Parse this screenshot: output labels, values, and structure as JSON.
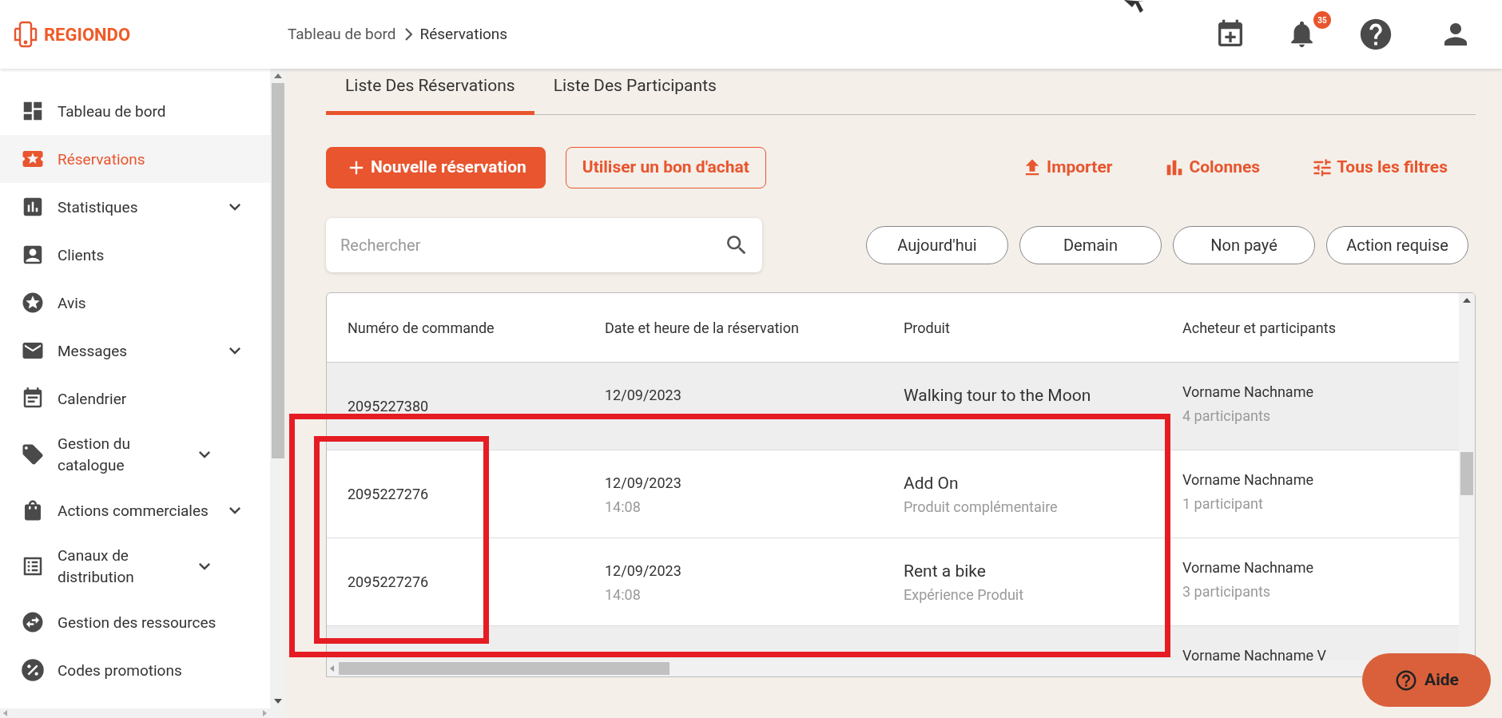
{
  "header": {
    "logo": "REGIONDO",
    "breadcrumb": [
      "Tableau de bord",
      "Réservations"
    ],
    "notifications_badge": "35"
  },
  "sidebar": {
    "items": [
      {
        "label": "Tableau de bord",
        "selected": false,
        "expandable": false
      },
      {
        "label": "Réservations",
        "selected": true,
        "expandable": false
      },
      {
        "label": "Statistiques",
        "selected": false,
        "expandable": true
      },
      {
        "label": "Clients",
        "selected": false,
        "expandable": false
      },
      {
        "label": "Avis",
        "selected": false,
        "expandable": false
      },
      {
        "label": "Messages",
        "selected": false,
        "expandable": true
      },
      {
        "label": "Calendrier",
        "selected": false,
        "expandable": false
      },
      {
        "label": "Gestion du catalogue",
        "selected": false,
        "expandable": true
      },
      {
        "label": "Actions commerciales",
        "selected": false,
        "expandable": true
      },
      {
        "label": "Canaux de distribution",
        "selected": false,
        "expandable": true
      },
      {
        "label": "Gestion des ressources",
        "selected": false,
        "expandable": false
      },
      {
        "label": "Codes promotions",
        "selected": false,
        "expandable": false
      }
    ]
  },
  "tabs": [
    {
      "label": "Liste Des Réservations",
      "selected": true
    },
    {
      "label": "Liste Des Participants",
      "selected": false
    }
  ],
  "actions": {
    "primary": "Nouvelle réservation",
    "secondary": "Utiliser un bon d'achat",
    "links": [
      "Importer",
      "Colonnes",
      "Tous les filtres"
    ]
  },
  "search": {
    "placeholder": "Rechercher"
  },
  "quick_filters": [
    {
      "label": "Aujourd'hui",
      "selected": false
    },
    {
      "label": "Demain",
      "selected": false
    },
    {
      "label": "Non payé",
      "selected": false
    },
    {
      "label": "Action requise",
      "selected": false
    }
  ],
  "table": {
    "columns": [
      "Numéro de commande",
      "Date et heure de la réservation",
      "Produit",
      "Acheteur et participants"
    ],
    "rows": [
      {
        "order": "2095227380",
        "date": "12/09/2023",
        "product": "Walking tour to the Moon",
        "buyer": "Vorname Nachname",
        "participants": "4 participants",
        "highlighted": true
      },
      {
        "order": "2095227276",
        "date": "12/09/2023",
        "time": "14:08",
        "product": "Add On",
        "product_type": "Produit complémentaire",
        "buyer": "Vorname Nachname",
        "participants": "1 participant",
        "highlighted": false
      },
      {
        "order": "2095227276",
        "date": "12/09/2023",
        "time": "14:08",
        "product": "Rent a bike",
        "product_type": "Expérience Produit",
        "buyer": "Vorname Nachname",
        "participants": "3 participants",
        "highlighted": false
      },
      {
        "buyer": "Vorname Nachname V",
        "highlighted": true
      }
    ]
  },
  "help_button": "Aide"
}
